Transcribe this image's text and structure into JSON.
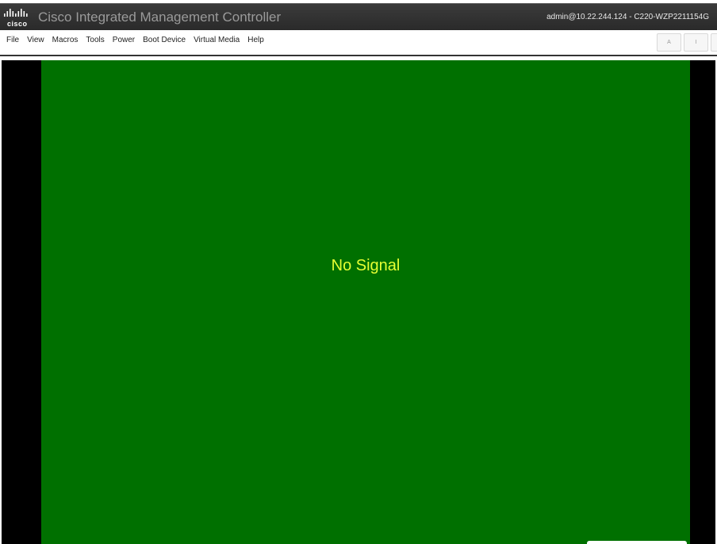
{
  "header": {
    "logo_text": "cisco",
    "title": "Cisco Integrated Management Controller",
    "session": "admin@10.22.244.124 - C220-WZP2211154G"
  },
  "menu": {
    "items": [
      "File",
      "View",
      "Macros",
      "Tools",
      "Power",
      "Boot Device",
      "Virtual Media",
      "Help"
    ]
  },
  "toolbar": {
    "btn1": "A",
    "btn2": "I"
  },
  "console": {
    "message": "No Signal"
  },
  "colors": {
    "titlebar": "#2f2f2f",
    "screen": "#007000",
    "message": "#e6ff33"
  }
}
